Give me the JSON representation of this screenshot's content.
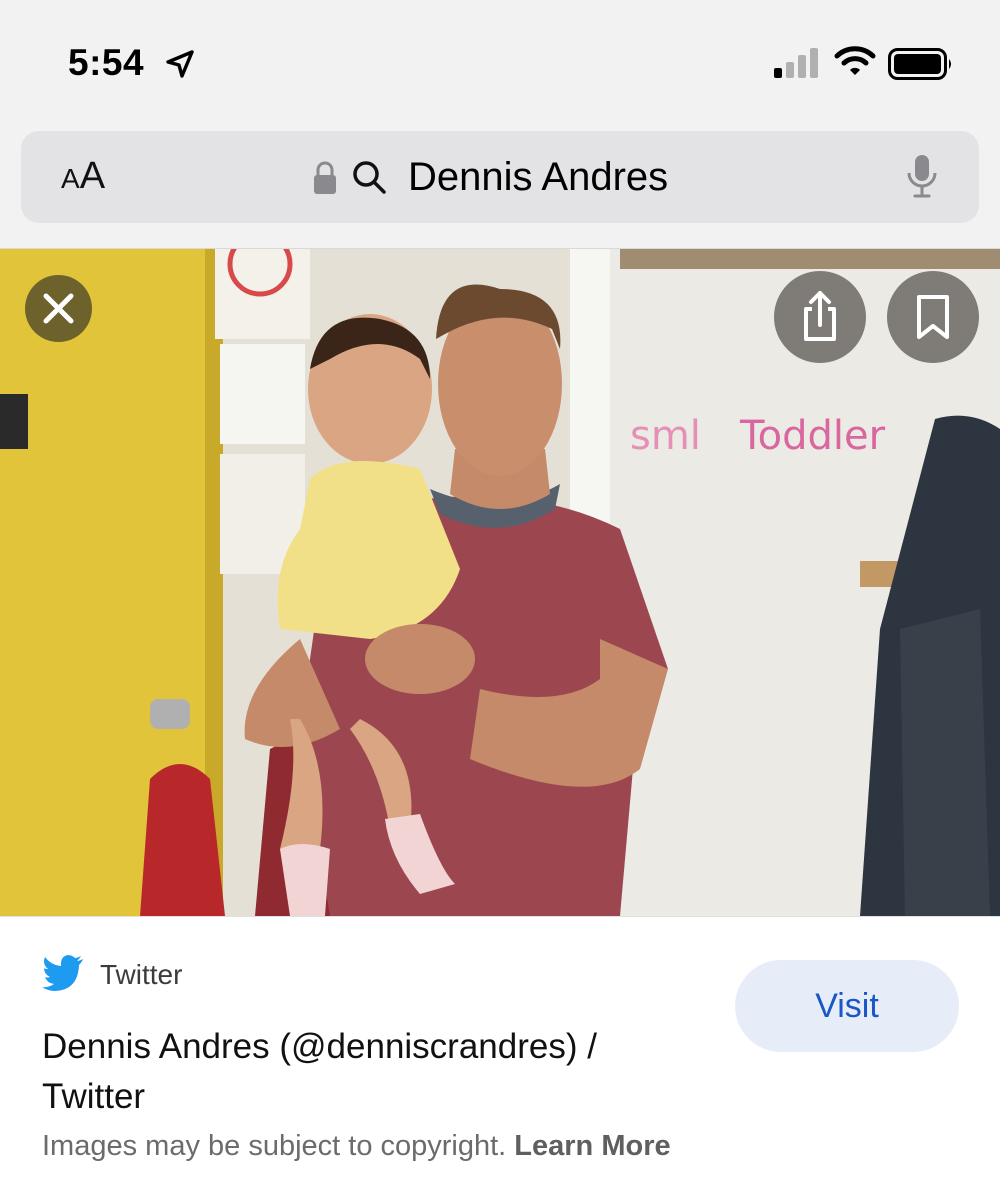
{
  "status_bar": {
    "time": "5:54",
    "icons": [
      "location-arrow-icon",
      "signal-icon",
      "wifi-icon",
      "battery-icon"
    ]
  },
  "address_bar": {
    "aa_small": "A",
    "aa_large": "A",
    "query": "Dennis Andres",
    "icons": [
      "lock-icon",
      "search-icon",
      "microphone-icon"
    ]
  },
  "image_viewer": {
    "buttons": [
      "close-icon",
      "share-icon",
      "bookmark-icon"
    ]
  },
  "result": {
    "source": "Twitter",
    "title": "Dennis Andres (@denniscrandres) / Twitter",
    "visit_label": "Visit",
    "copyright_text": "Images may be subject to copyright.",
    "learn_more_label": "Learn More"
  },
  "colors": {
    "accent": "#1a56c4",
    "visit_bg": "#e6edf8",
    "twitter_blue": "#1d9bf0"
  }
}
